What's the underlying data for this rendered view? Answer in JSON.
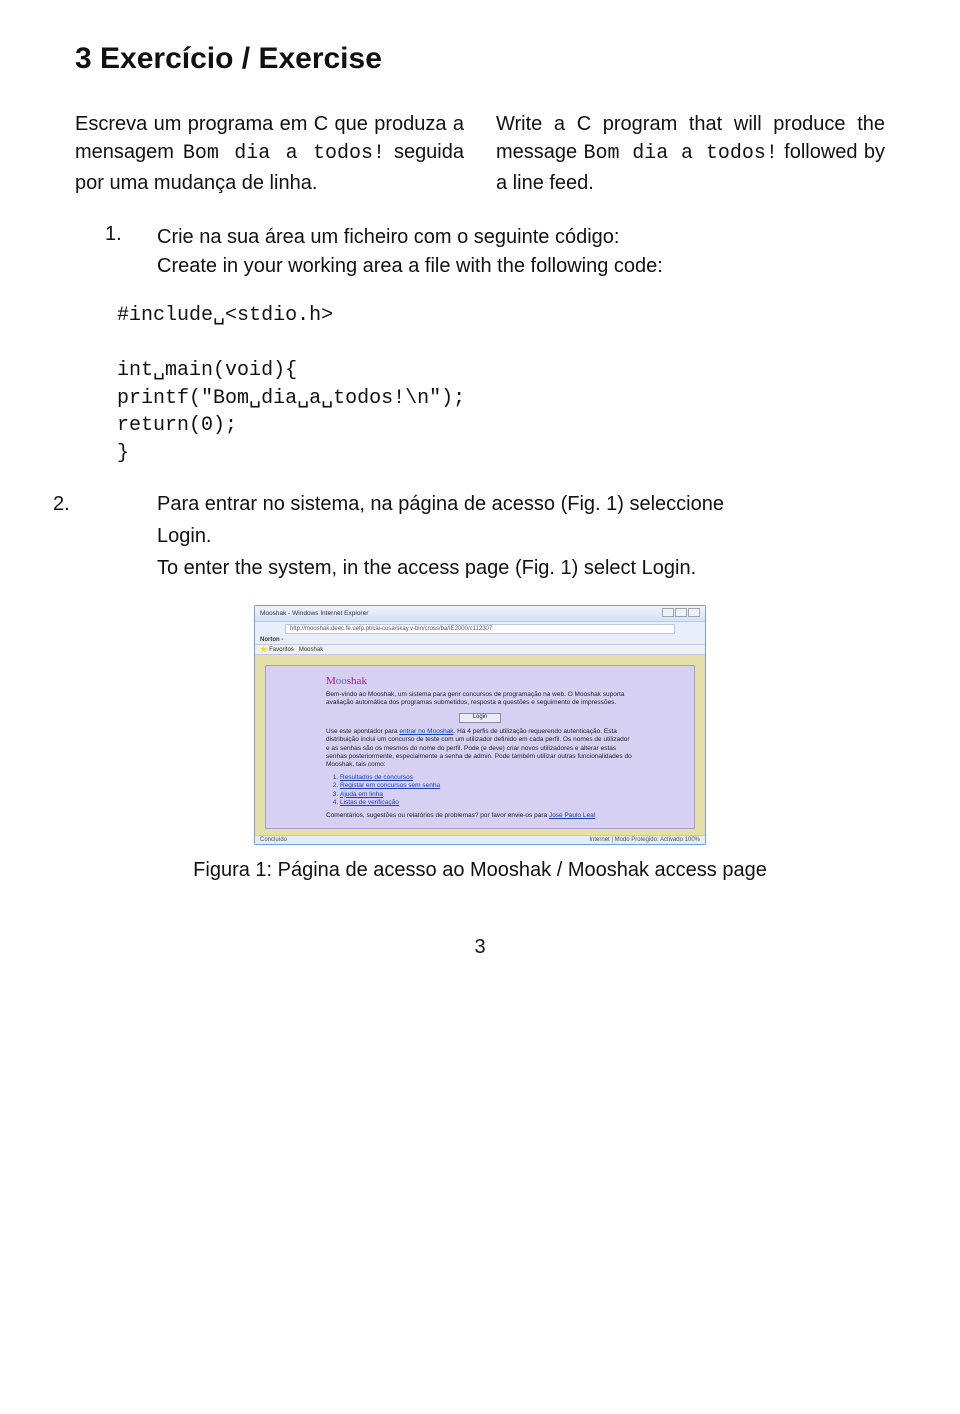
{
  "section_title": "3  Exercício / Exercise",
  "intro": {
    "pt_1": "Escreva um programa em C que produza a mensagem ",
    "pt_code": "Bom dia a todos!",
    "pt_2": " seguida por uma mudança de linha.",
    "en_1": "Write a C program that will produce the message ",
    "en_code": "Bom dia a todos!",
    "en_2": " followed by a line feed."
  },
  "step1": {
    "num": "1.",
    "pt": "Crie na sua área um ficheiro com o seguinte código:",
    "en": "Create in your working area a file with the following code:"
  },
  "code": {
    "l1": "#include␣<stdio.h>",
    "l2": "int␣main(void){",
    "l3": "printf(\"Bom␣dia␣a␣todos!\\n\");",
    "l4": "return(0);",
    "l5": "}"
  },
  "step2": {
    "num": "2.",
    "line1a": "Para entrar no sistema, na página de acesso (Fig. 1) seleccione",
    "line1b": "Login.",
    "line2": "To enter the system, in the access page (Fig. 1) select Login."
  },
  "browser": {
    "title_left": "Mooshak - Windows Internet Explorer",
    "addr": "http://mooshak.deec.fe.uefp.pt/cai-cosa/skay.v-bin/cross/ba/IE2000/c112307",
    "norton_label": "Norton -",
    "tab1": "Favoritos",
    "tab2": "Mooshak",
    "logo_m": "M",
    "logo_oo": "oo",
    "logo_rest": "shak",
    "p1": "Bem-vindo ao Mooshak, um sistema para gerir concursos de programação na web. O Mooshak suporta avaliação automática dos programas submetidos, resposta a questões e seguimento de impressões.",
    "login_label": "Login",
    "p2a": "Use este apontador para ",
    "p2_link": "entrar no Mooshak",
    "p2b": ". Há 4 perfis de utilização requerendo autenticação. Esta distribuição inclui um concurso de teste com um utilizador definido em cada perfil. Os nomes de utilizador e as senhas são os mesmos do nome do perfil. Pode (e deve) criar novos utilizadores e alterar estas senhas posteriormente, especialmente a senha de admin. Pode também utilizar outras funcionalidades do Mooshak, tais como:",
    "li1": "Resultados de concursos",
    "li2": "Registar em concursos sem senha",
    "li3": "Ajuda em linha",
    "li4": "Listas de verificação",
    "p3a": "Comentários, sugestões ou relatórios de problemas? por favor envie-os para ",
    "p3_link": "José Paulo Leal",
    "status_left": "Concluído",
    "status_right": "Internet | Modo Protegido: Activado        100%"
  },
  "figure_caption": "Figura 1: Página de acesso ao Mooshak / Mooshak access page",
  "page_number": "3",
  "chart_data": {
    "type": "table",
    "title": "C source code listing",
    "rows": [
      "#include <stdio.h>",
      "",
      "int main(void){",
      "printf(\"Bom dia a todos!\\n\");",
      "return(0);",
      "}"
    ]
  }
}
